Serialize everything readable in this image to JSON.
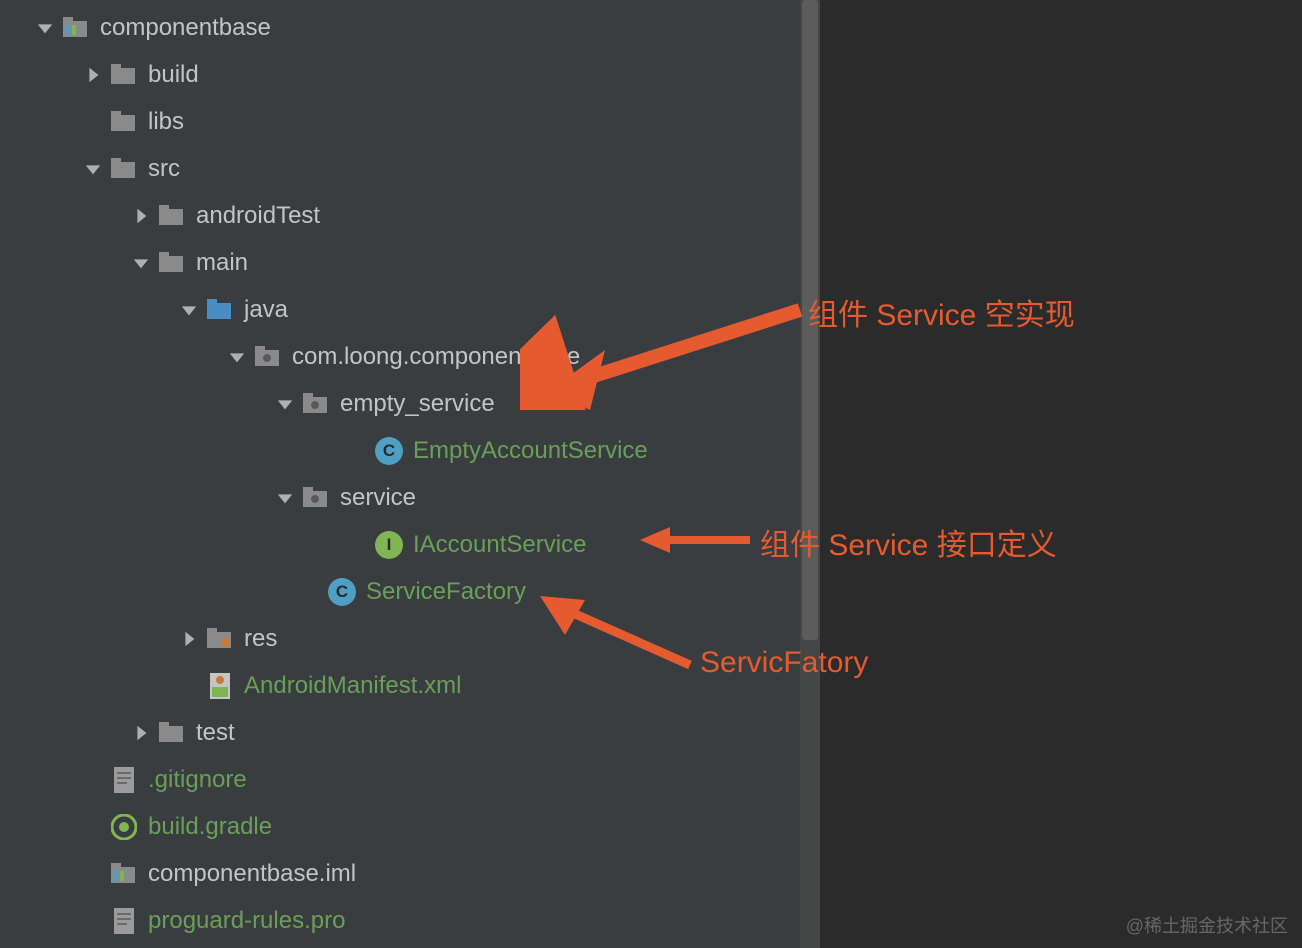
{
  "tree": {
    "componentbase": "componentbase",
    "build": "build",
    "libs": "libs",
    "src": "src",
    "androidTest": "androidTest",
    "main": "main",
    "java": "java",
    "package": "com.loong.componentbase",
    "empty_service": "empty_service",
    "EmptyAccountService": "EmptyAccountService",
    "service": "service",
    "IAccountService": "IAccountService",
    "ServiceFactory": "ServiceFactory",
    "res": "res",
    "AndroidManifest": "AndroidManifest.xml",
    "test": "test",
    "gitignore": ".gitignore",
    "buildgradle": "build.gradle",
    "iml": "componentbase.iml",
    "proguard": "proguard-rules.pro"
  },
  "annotations": {
    "a1": "组件 Service 空实现",
    "a2": "组件 Service 接口定义",
    "a3": "ServicFatory"
  },
  "watermark": "@稀土掘金技术社区",
  "badges": {
    "c": "C",
    "i": "I"
  }
}
